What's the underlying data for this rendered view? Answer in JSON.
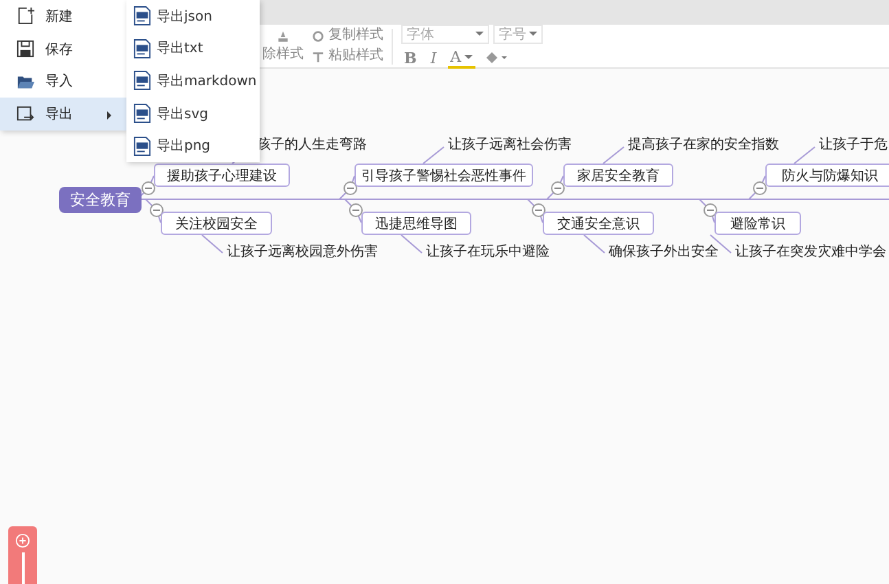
{
  "file_menu": {
    "items": [
      {
        "label": "新建",
        "selected": false,
        "submenu": false
      },
      {
        "label": "保存",
        "selected": false,
        "submenu": false
      },
      {
        "label": "导入",
        "selected": false,
        "submenu": false
      },
      {
        "label": "导出",
        "selected": true,
        "submenu": true
      }
    ]
  },
  "export_submenu": {
    "items": [
      "导出json",
      "导出txt",
      "导出markdown",
      "导出svg",
      "导出png"
    ]
  },
  "toolbar": {
    "clear_style": "除样式",
    "copy_style": "复制样式",
    "paste_style": "粘贴样式",
    "font": "字体",
    "size": "字号",
    "bold": "B",
    "italic": "I",
    "font_color": "A"
  },
  "mindmap": {
    "root": "安全教育",
    "branches": [
      {
        "topic": "援助孩子心理建设",
        "note": "孩子的人生走弯路"
      },
      {
        "topic": "关注校园安全",
        "note": "让孩子远离校园意外伤害"
      },
      {
        "topic": "引导孩子警惕社会恶性事件",
        "note": "让孩子远离社会伤害"
      },
      {
        "topic": "迅捷思维导图",
        "note": "让孩子在玩乐中避险"
      },
      {
        "topic": "家居安全教育",
        "note": "提高孩子在家的安全指数"
      },
      {
        "topic": "交通安全意识",
        "note": "确保孩子外出安全"
      },
      {
        "topic": "防火与防爆知识",
        "note": "让孩子于危"
      },
      {
        "topic": "避险常识",
        "note": "让孩子在突发灾难中学会"
      }
    ]
  }
}
